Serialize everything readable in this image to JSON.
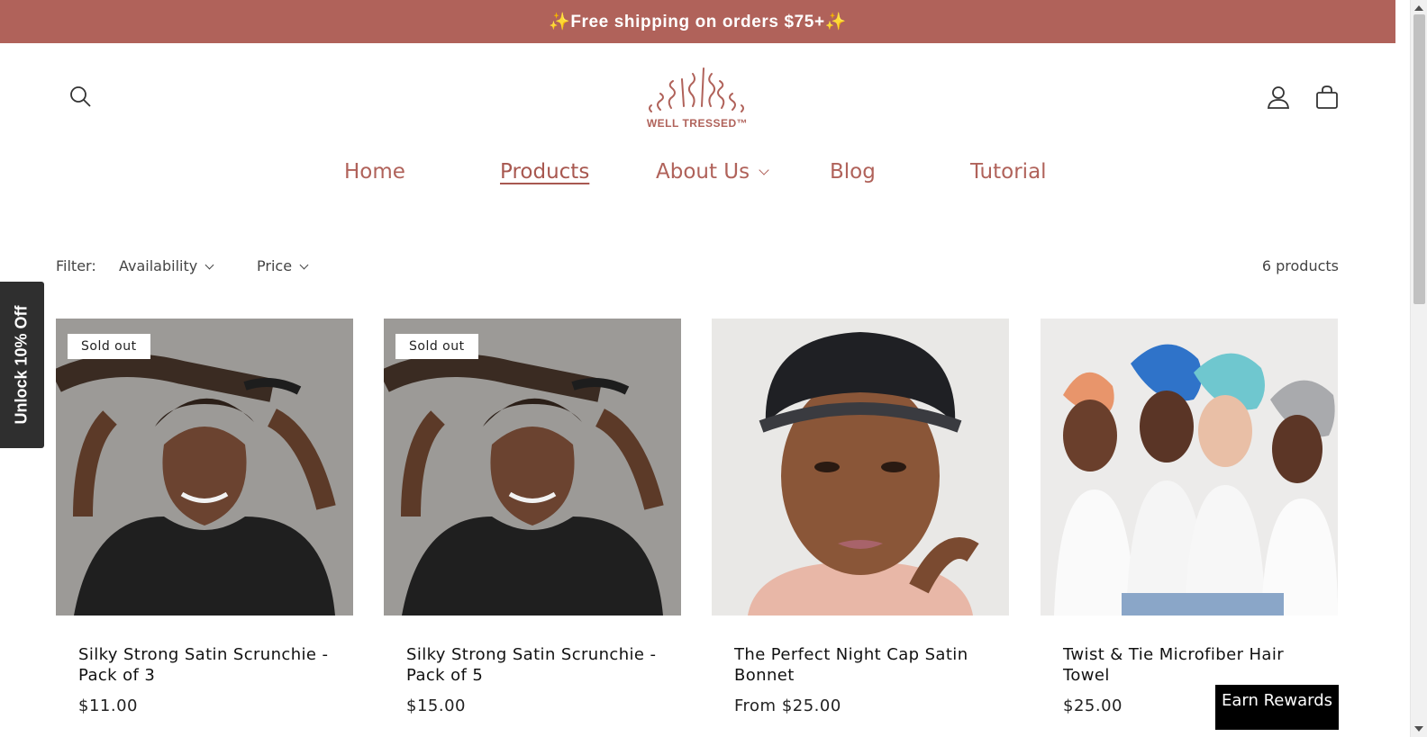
{
  "announcement": {
    "text": "✨Free shipping on orders $75+✨"
  },
  "header": {
    "logo_text": "WELL TRESSED™",
    "icons": {
      "search": "search-icon",
      "account": "account-icon",
      "cart": "cart-icon"
    }
  },
  "nav": {
    "items": [
      {
        "label": "Home"
      },
      {
        "label": "Products"
      },
      {
        "label": "About Us"
      },
      {
        "label": "Blog"
      },
      {
        "label": "Tutorial"
      }
    ],
    "active": "Products"
  },
  "filters": {
    "label": "Filter:",
    "availability": "Availability",
    "price": "Price",
    "count": "6 products"
  },
  "side_tab": {
    "label": "Unlock 10% Off"
  },
  "products": [
    {
      "title": "Silky Strong Satin Scrunchie - Pack of 3",
      "price": "$11.00",
      "badge": "Sold out"
    },
    {
      "title": "Silky Strong Satin Scrunchie - Pack of 5",
      "price": "$15.00",
      "badge": "Sold out"
    },
    {
      "title": "The Perfect Night Cap Satin Bonnet",
      "price": "From $25.00",
      "badge": ""
    },
    {
      "title": "Twist & Tie Microfiber Hair Towel",
      "price": "$25.00",
      "badge": ""
    }
  ],
  "rewards": {
    "label": "Earn Rewards"
  },
  "colors": {
    "brand": "#b0625a",
    "dark": "#2f2f2f"
  }
}
